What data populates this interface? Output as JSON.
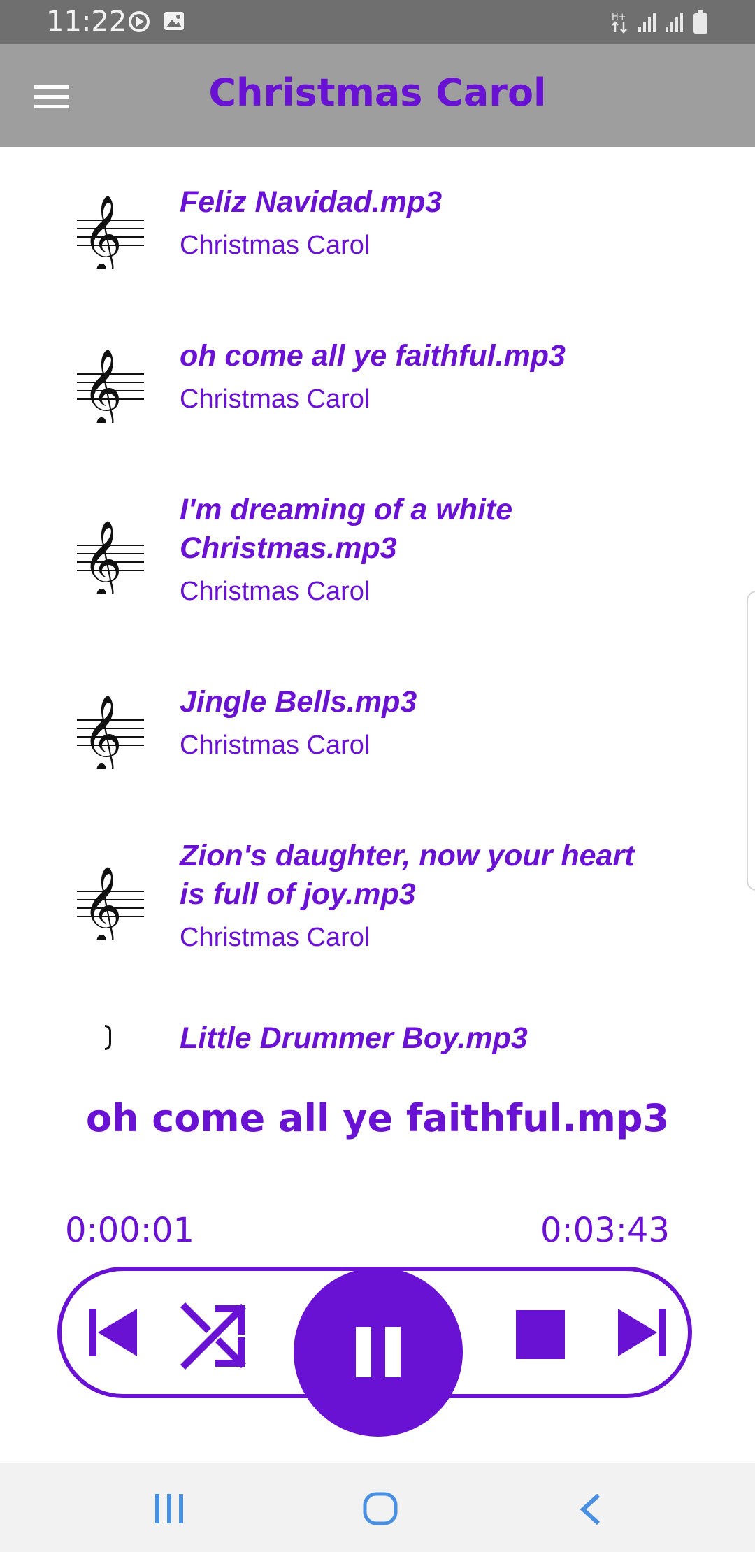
{
  "status_bar": {
    "time": "11:22"
  },
  "app_bar": {
    "title": "Christmas Carol"
  },
  "songs": [
    {
      "title": "Feliz Navidad.mp3",
      "artist": "Christmas Carol"
    },
    {
      "title": "oh come all ye faithful.mp3",
      "artist": "Christmas Carol"
    },
    {
      "title": "I'm dreaming of a white Christmas.mp3",
      "artist": "Christmas Carol"
    },
    {
      "title": "Jingle Bells.mp3",
      "artist": "Christmas Carol"
    },
    {
      "title": "Zion's daughter, now your heart is full of joy.mp3",
      "artist": "Christmas Carol"
    },
    {
      "title": "Little Drummer Boy.mp3",
      "artist": ""
    }
  ],
  "player": {
    "now_playing": "oh come all ye faithful.mp3",
    "current_time": "0:00:01",
    "total_time": "0:03:43"
  },
  "colors": {
    "accent": "#6a12d4",
    "appbar": "#9e9e9e",
    "statusbar": "#6f6f6f"
  },
  "icons": [
    "menu-icon",
    "treble-clef-icon",
    "previous-icon",
    "shuffle-icon",
    "pause-icon",
    "stop-icon",
    "next-icon",
    "recents-icon",
    "home-icon",
    "back-icon"
  ]
}
